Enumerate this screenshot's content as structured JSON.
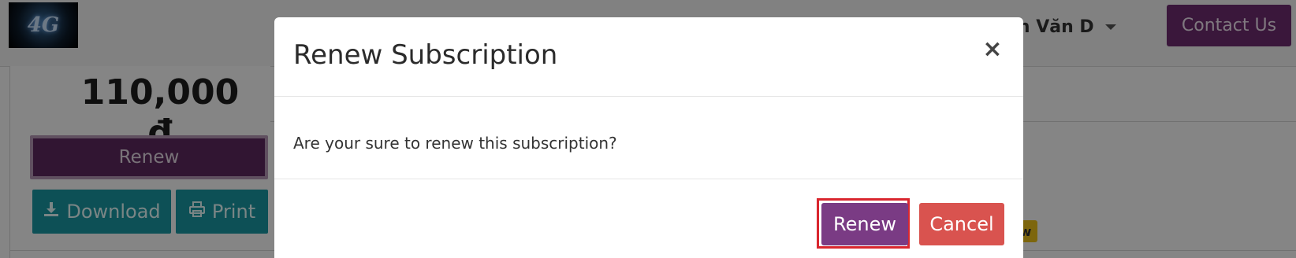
{
  "header": {
    "logo_text": "4G",
    "user_name_partial": "ên Văn D",
    "contact_button": "Contact Us"
  },
  "side_panel": {
    "price": "110,000 đ",
    "renew_button": "Renew",
    "download_button": "Download",
    "print_button": "Print",
    "badge_text": "w"
  },
  "modal": {
    "title": "Renew Subscription",
    "close_symbol": "×",
    "message": "Are your sure to renew this subscription?",
    "renew_button": "Renew",
    "cancel_button": "Cancel"
  },
  "colors": {
    "brand_purple": "#6f2c72",
    "teal": "#1a9aa6",
    "danger": "#d9534f",
    "highlight": "#d9262e"
  },
  "icons": {
    "download": "download-icon",
    "print": "printer-icon",
    "caret": "caret-down-icon",
    "close": "close-icon"
  }
}
